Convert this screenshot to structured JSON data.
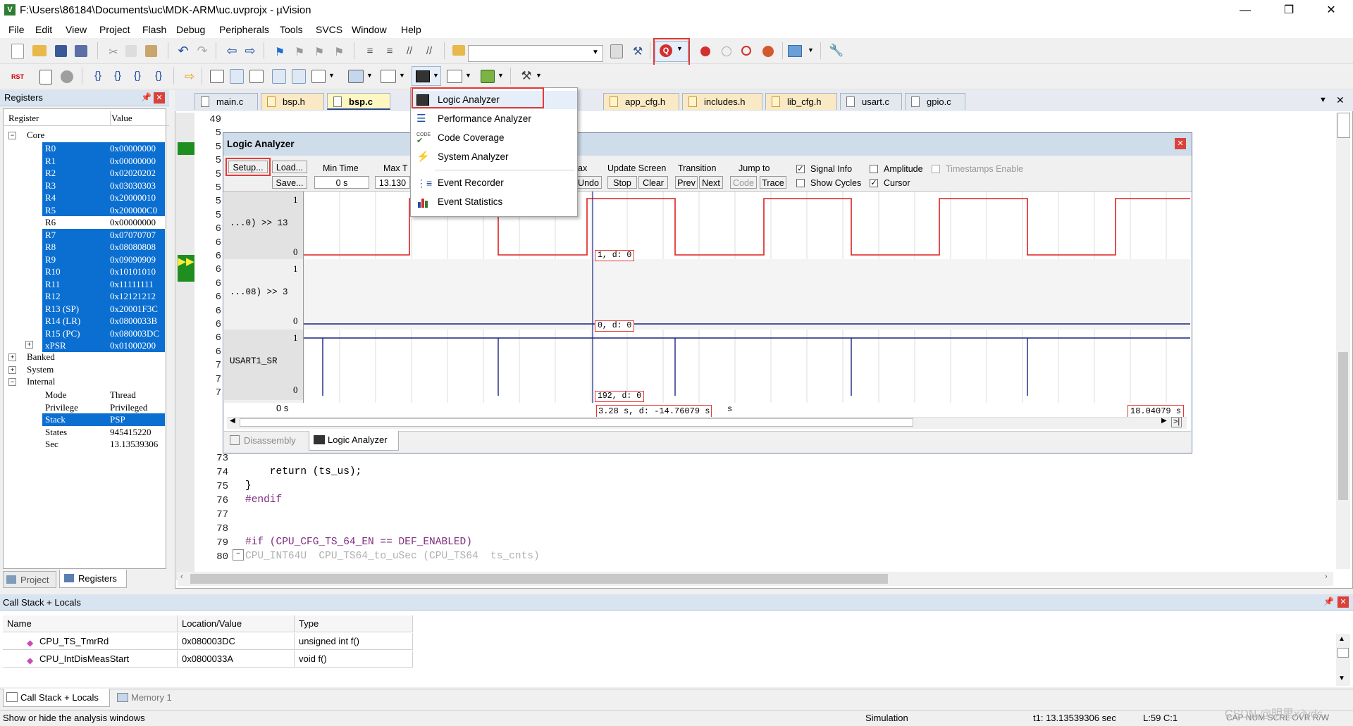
{
  "window": {
    "title": "F:\\Users\\86184\\Documents\\uc\\MDK-ARM\\uc.uvprojx - µVision",
    "min": "—",
    "max": "❐",
    "close": "✕"
  },
  "menu": [
    "File",
    "Edit",
    "View",
    "Project",
    "Flash",
    "Debug",
    "Peripherals",
    "Tools",
    "SVCS",
    "Window",
    "Help"
  ],
  "registers": {
    "title": "Registers",
    "col_register": "Register",
    "col_value": "Value",
    "core_label": "Core",
    "rows": [
      {
        "name": "R0",
        "value": "0x00000000",
        "sel": true
      },
      {
        "name": "R1",
        "value": "0x00000000",
        "sel": true
      },
      {
        "name": "R2",
        "value": "0x02020202",
        "sel": true
      },
      {
        "name": "R3",
        "value": "0x03030303",
        "sel": true
      },
      {
        "name": "R4",
        "value": "0x20000010",
        "sel": true
      },
      {
        "name": "R5",
        "value": "0x200000C0",
        "sel": true
      },
      {
        "name": "R6",
        "value": "0x00000000",
        "sel": false
      },
      {
        "name": "R7",
        "value": "0x07070707",
        "sel": true
      },
      {
        "name": "R8",
        "value": "0x08080808",
        "sel": true
      },
      {
        "name": "R9",
        "value": "0x09090909",
        "sel": true
      },
      {
        "name": "R10",
        "value": "0x10101010",
        "sel": true
      },
      {
        "name": "R11",
        "value": "0x11111111",
        "sel": true
      },
      {
        "name": "R12",
        "value": "0x12121212",
        "sel": true
      },
      {
        "name": "R13 (SP)",
        "value": "0x20001F3C",
        "sel": true
      },
      {
        "name": "R14 (LR)",
        "value": "0x0800033B",
        "sel": true
      },
      {
        "name": "R15 (PC)",
        "value": "0x080003DC",
        "sel": true
      },
      {
        "name": "xPSR",
        "value": "0x01000200",
        "sel": true
      }
    ],
    "groups": [
      "Banked",
      "System",
      "Internal"
    ],
    "internal": [
      {
        "name": "Mode",
        "value": "Thread",
        "sel": false
      },
      {
        "name": "Privilege",
        "value": "Privileged",
        "sel": false
      },
      {
        "name": "Stack",
        "value": "PSP",
        "sel": true
      },
      {
        "name": "States",
        "value": "945415220",
        "sel": false
      },
      {
        "name": "Sec",
        "value": "13.13539306",
        "sel": false
      }
    ],
    "tab_project": "Project",
    "tab_registers": "Registers"
  },
  "editor_tabs": [
    "main.c",
    "bsp.h",
    "bsp.c",
    "app_cfg.h",
    "includes.h",
    "lib_cfg.h",
    "usart.c",
    "gpio.c"
  ],
  "analysis_menu": [
    "Logic Analyzer",
    "Performance Analyzer",
    "Code Coverage",
    "System Analyzer",
    "Event Recorder",
    "Event Statistics"
  ],
  "code_icon_text": "CODE",
  "logic": {
    "title": "Logic Analyzer",
    "setup": "Setup...",
    "load": "Load...",
    "save": "Save...",
    "min_time_label": "Min Time",
    "min_time": "0 s",
    "max_time_label": "Max T",
    "max_time": "13.130",
    "ax_label": "ax",
    "undo": "Undo",
    "update_screen": "Update Screen",
    "stop": "Stop",
    "clear": "Clear",
    "transition": "Transition",
    "prev": "Prev",
    "next": "Next",
    "jump_to": "Jump to",
    "code": "Code",
    "trace": "Trace",
    "signal_info": "Signal Info",
    "show_cycles": "Show Cycles",
    "amplitude": "Amplitude",
    "cursor": "Cursor",
    "timestamps": "Timestamps Enable",
    "signals": [
      {
        "name": "...0) >> 13",
        "hi": "1",
        "lo": "0",
        "readout": "1,  d: 0"
      },
      {
        "name": "...08) >> 3",
        "hi": "1",
        "lo": "0",
        "readout": "0,  d: 0"
      },
      {
        "name": "USART1_SR",
        "hi": "1",
        "lo": "0",
        "readout": "192,  d: 0"
      }
    ],
    "time_start": "0 s",
    "cursor_time": "3.28 s,  d: -14.76079 s",
    "time_suffix": "s",
    "time_end": "18.04079 s",
    "tab_disassembly": "Disassembly",
    "tab_logic": "Logic Analyzer"
  },
  "code_lines": {
    "top": [
      "49",
      "5",
      "5",
      "5",
      "5",
      "5",
      "5",
      "5",
      "6",
      "6",
      "6",
      "6",
      "6",
      "6",
      "6",
      "6",
      "6",
      "6",
      "7",
      "7",
      "7"
    ],
    "bottom": [
      {
        "n": "73",
        "t": ""
      },
      {
        "n": "74",
        "t": "    return (ts_us);"
      },
      {
        "n": "75",
        "t": "}"
      },
      {
        "n": "76",
        "t": "#endif"
      },
      {
        "n": "77",
        "t": ""
      },
      {
        "n": "78",
        "t": ""
      },
      {
        "n": "79",
        "t": "#if (CPU_CFG_TS_64_EN == DEF_ENABLED)"
      },
      {
        "n": "80",
        "t": "CPU_INT64U  CPU_TS64_to_uSec (CPU_TS64  ts_cnts)"
      }
    ]
  },
  "callstack": {
    "title": "Call Stack + Locals",
    "headers": [
      "Name",
      "Location/Value",
      "Type"
    ],
    "rows": [
      {
        "name": "CPU_TS_TmrRd",
        "loc": "0x080003DC",
        "type": "unsigned int f()"
      },
      {
        "name": "CPU_IntDisMeasStart",
        "loc": "0x0800033A",
        "type": "void f()"
      }
    ],
    "tab_callstack": "Call Stack + Locals",
    "tab_memory": "Memory 1"
  },
  "status": {
    "hint": "Show or hide the analysis windows",
    "mode": "Simulation",
    "time": "t1: 13.13539306 sec",
    "pos": "L:59 C:1",
    "caps": "CAP  NUM  SCRL  OVR  R/W",
    "watermark": "CSDN @明里x∂yds"
  },
  "colors": {
    "accent": "#0b6fd1",
    "wave_red": "#e02020",
    "wave_blue": "#1a237e",
    "highlight": "#e53935",
    "panel_header": "#d9e4f1"
  }
}
